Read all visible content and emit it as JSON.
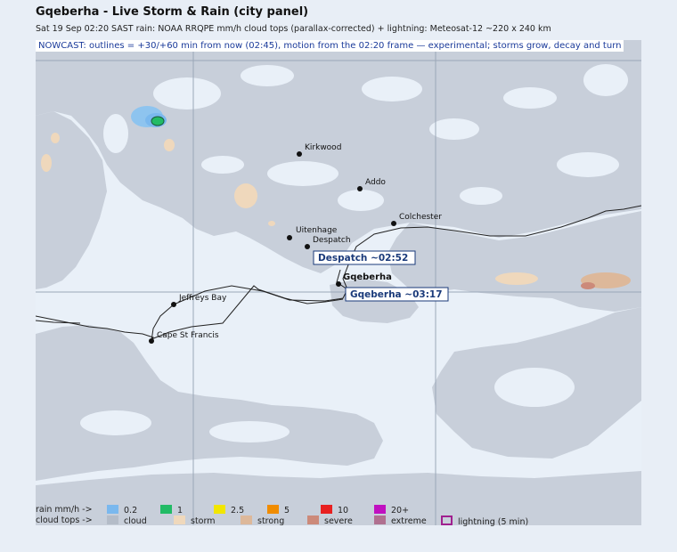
{
  "header": {
    "title": "Gqeberha - Live Storm & Rain (city panel)",
    "subtitle": "Sat 19 Sep 02:20 SAST   rain: NOAA RRQPE mm/h   cloud tops (parallax-corrected) + lightning: Meteosat-12   ~220 x 240 km"
  },
  "nowcast": {
    "text": "NOWCAST: outlines = +30/+60 min from now (02:45), motion from the 02:20 frame",
    "warning": " — experimental; storms grow, decay and turn"
  },
  "map": {
    "places": [
      {
        "name": "Kirkwood"
      },
      {
        "name": "Addo"
      },
      {
        "name": "Colchester"
      },
      {
        "name": "Uitenhage"
      },
      {
        "name": "Despatch"
      },
      {
        "name": "Gqeberha"
      },
      {
        "name": "Jeffreys Bay"
      },
      {
        "name": "Cape St Francis"
      }
    ],
    "eta_labels": [
      {
        "text": "Despatch ~02:52"
      },
      {
        "text": "Gqeberha ~03:17"
      }
    ]
  },
  "legend": {
    "rain_label": "rain mm/h ->",
    "rain_items": [
      {
        "label": "0.2",
        "color": "#7ab8ee"
      },
      {
        "label": "1",
        "color": "#22bb66"
      },
      {
        "label": "2.5",
        "color": "#f2e600"
      },
      {
        "label": "5",
        "color": "#f08c00"
      },
      {
        "label": "10",
        "color": "#e82020"
      },
      {
        "label": "20+",
        "color": "#c010c0"
      }
    ],
    "cloud_label": "cloud tops ->",
    "cloud_items": [
      {
        "label": "cloud",
        "color": "#b4bcc8"
      },
      {
        "label": "storm",
        "color": "#efd8bc"
      },
      {
        "label": "strong",
        "color": "#ddb89a"
      },
      {
        "label": "severe",
        "color": "#cc8a7a"
      },
      {
        "label": "extreme",
        "color": "#b07090"
      },
      {
        "label": "lightning (5 min)",
        "color": "#a0208f"
      }
    ]
  }
}
